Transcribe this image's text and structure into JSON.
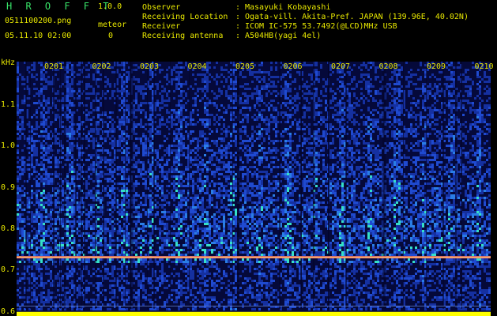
{
  "app": {
    "title": "H R O F F T",
    "version": "1.0.0"
  },
  "file": {
    "name": "0511100200.png",
    "datetime": "05.11.10 02:00"
  },
  "meteor": {
    "label": "meteor",
    "count": "0"
  },
  "meta": [
    {
      "key": "Observer",
      "sep": ":",
      "value": "Masayuki Kobayashi"
    },
    {
      "key": "Receiving Location",
      "sep": ":",
      "value": "Ogata-vill. Akita-Pref. JAPAN (139.96E, 40.02N)"
    },
    {
      "key": "Receiver",
      "sep": ":",
      "value": "ICOM IC-575 53.7492(@LCD)MHz USB"
    },
    {
      "key": "Receiving antenna",
      "sep": ":",
      "value": "A504HB(yagi 4el)"
    }
  ],
  "spectrogram": {
    "y_unit": "kHz",
    "y_ticks": [
      "1.1",
      "1.0",
      "0.9",
      "0.8",
      "0.7",
      "0.6"
    ],
    "y_values": [
      1.1,
      1.0,
      0.9,
      0.8,
      0.7,
      0.6
    ],
    "y_range": [
      0.59,
      1.205
    ],
    "x_ticks": [
      "0201",
      "0202",
      "0203",
      "0204",
      "0205",
      "0206",
      "0207",
      "0208",
      "0209",
      "0210"
    ],
    "carrier_khz": 0.733,
    "colors": {
      "background": "#000000",
      "label": "#e8e800",
      "title": "#39e66a",
      "band": "#ffff00"
    }
  }
}
